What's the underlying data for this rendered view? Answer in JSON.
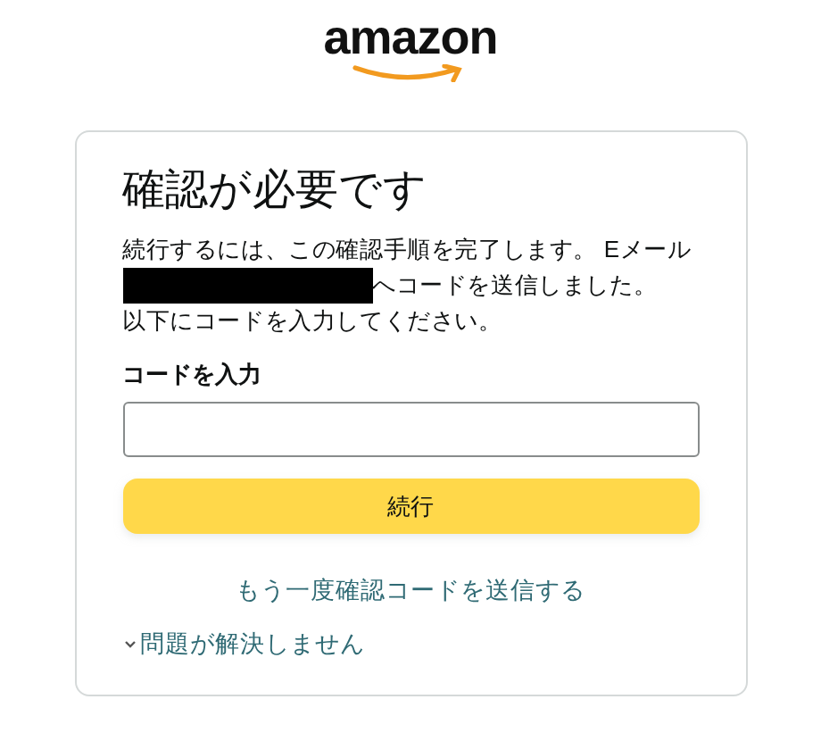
{
  "logo": {
    "text": "amazon"
  },
  "card": {
    "title": "確認が必要です",
    "message_before": "続行するには、この確認手順を完了します。 Eメール",
    "message_redacted": true,
    "message_after": "へコードを送信しました。",
    "instruction": "以下にコードを入力してください。",
    "code_field": {
      "label": "コードを入力"
    },
    "continue_button": "続行",
    "resend_link": "もう一度確認コードを送信する",
    "help_toggle": {
      "label": "問題が解決しません",
      "expanded": false
    }
  }
}
